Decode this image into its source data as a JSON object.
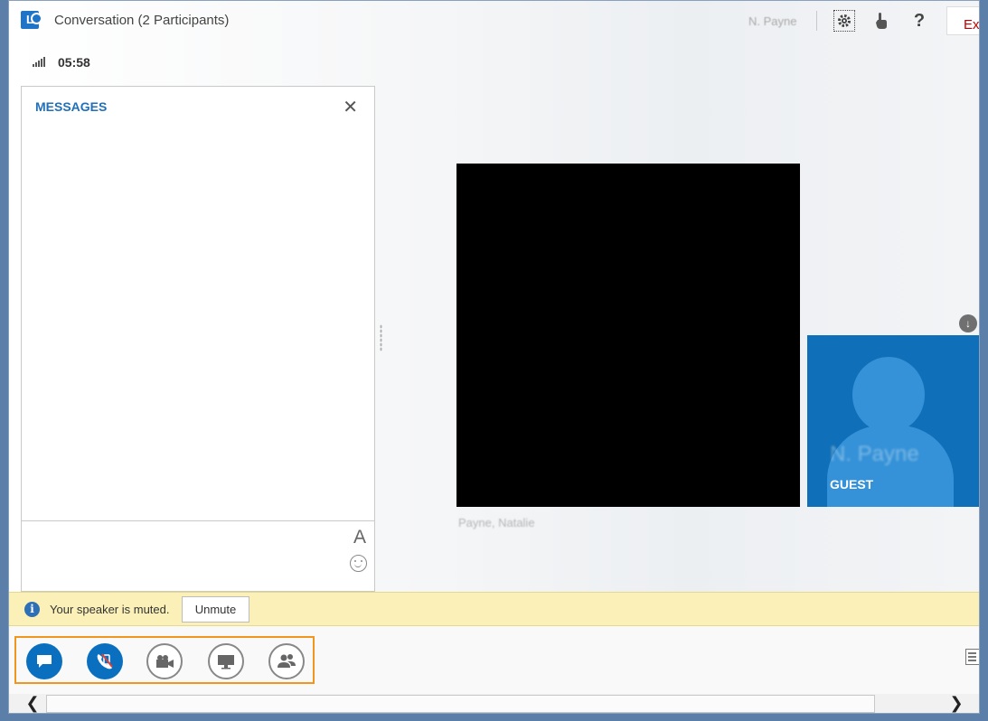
{
  "window": {
    "title": "Conversation (2 Participants)",
    "user_name": "N. Payne",
    "exit_label": "Exit",
    "help_label": "?",
    "call_timer": "05:58"
  },
  "messages_panel": {
    "title": "MESSAGES",
    "close_label": "✕",
    "font_label": "A"
  },
  "stage": {
    "video_participant_name": "Payne, Natalie",
    "guest_tile_name": "N. Payne",
    "guest_label": "GUEST"
  },
  "notification": {
    "info_label": "i",
    "text": "Your speaker is muted.",
    "button_label": "Unmute"
  },
  "controls": {
    "items": [
      {
        "name": "IM",
        "icon": "chat-bubble-icon",
        "state": "active"
      },
      {
        "name": "Audio",
        "icon": "phone-muted-icon",
        "state": "active"
      },
      {
        "name": "Video",
        "icon": "video-camera-icon",
        "state": "inactive"
      },
      {
        "name": "Present",
        "icon": "monitor-icon",
        "state": "inactive"
      },
      {
        "name": "Participants",
        "icon": "people-icon",
        "state": "inactive"
      }
    ]
  },
  "scrollbar": {
    "left_arrow": "❮",
    "right_arrow": "❯"
  },
  "colors": {
    "accent_blue": "#0b6fbf",
    "title_blue": "#1f6fb9",
    "notice_yellow": "#fbf1b8",
    "highlight_orange": "#f0961e",
    "exit_red": "#c00000"
  }
}
